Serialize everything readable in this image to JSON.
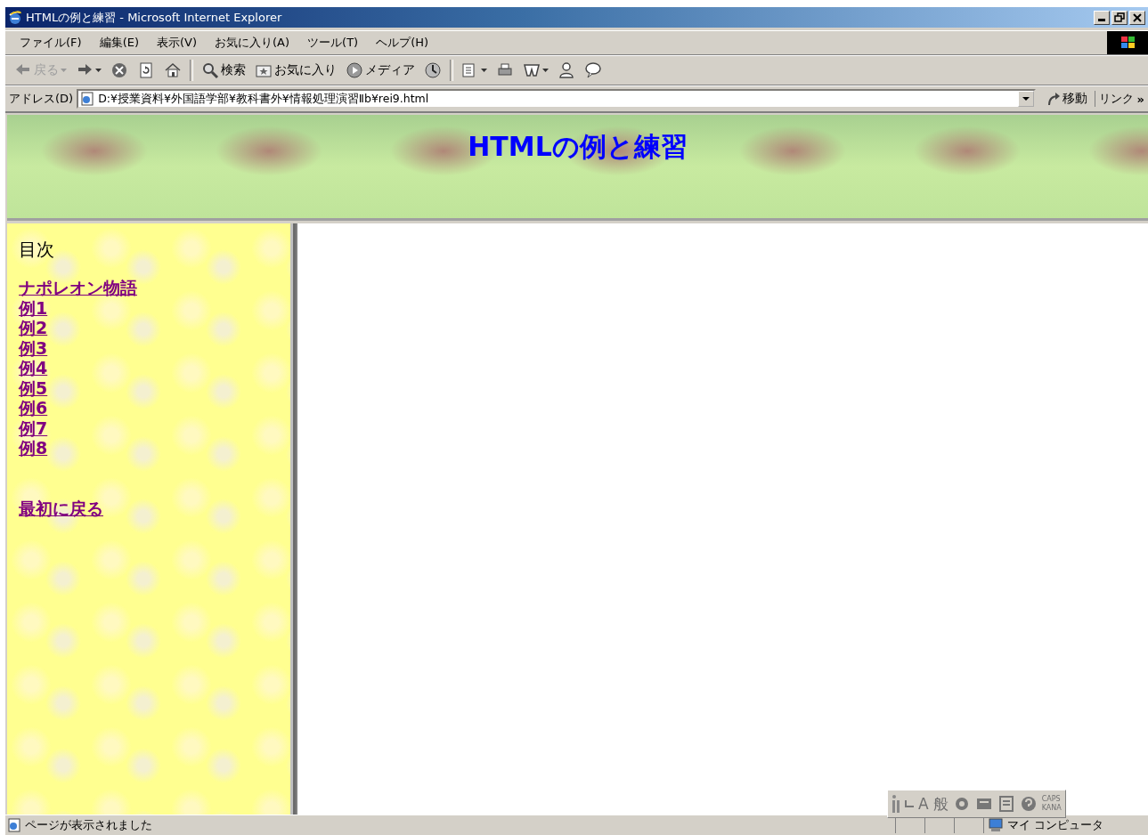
{
  "window": {
    "title": "HTMLの例と練習 - Microsoft Internet Explorer"
  },
  "menu": [
    "ファイル(F)",
    "編集(E)",
    "表示(V)",
    "お気に入り(A)",
    "ツール(T)",
    "ヘルプ(H)"
  ],
  "toolbar": [
    {
      "kind": "back",
      "label": "戻る",
      "disabled": true,
      "dropdown": true,
      "separator_after": false
    },
    {
      "kind": "forward",
      "disabled": false,
      "dropdown": true,
      "separator_after": false
    },
    {
      "kind": "stop",
      "disabled": false,
      "dropdown": false,
      "separator_after": false
    },
    {
      "kind": "refresh",
      "disabled": false,
      "dropdown": false,
      "separator_after": false
    },
    {
      "kind": "home",
      "disabled": false,
      "dropdown": false,
      "separator_after": true
    },
    {
      "kind": "search",
      "label": "検索",
      "disabled": false,
      "dropdown": false,
      "separator_after": false
    },
    {
      "kind": "favorites",
      "label": "お気に入り",
      "disabled": false,
      "dropdown": false,
      "separator_after": false
    },
    {
      "kind": "media",
      "label": "メディア",
      "disabled": false,
      "dropdown": false,
      "separator_after": false
    },
    {
      "kind": "history",
      "disabled": false,
      "dropdown": false,
      "separator_after": true
    },
    {
      "kind": "mail",
      "disabled": false,
      "dropdown": true,
      "separator_after": false
    },
    {
      "kind": "print",
      "disabled": false,
      "dropdown": false,
      "separator_after": false
    },
    {
      "kind": "edit",
      "disabled": false,
      "dropdown": true,
      "separator_after": false
    },
    {
      "kind": "discuss",
      "disabled": false,
      "dropdown": false,
      "separator_after": false
    },
    {
      "kind": "messenger",
      "disabled": false,
      "dropdown": false,
      "separator_after": false
    }
  ],
  "address": {
    "label": "アドレス(D)",
    "value": "D:¥授業資料¥外国語学部¥教科書外¥情報処理演習Ⅱb¥rei9.html",
    "go": "移動",
    "links": "リンク",
    "more": "»"
  },
  "page": {
    "heading": "HTMLの例と練習",
    "sidebar": {
      "title": "目次",
      "links": [
        "ナポレオン物語",
        "例1",
        "例2",
        "例3",
        "例4",
        "例5",
        "例6",
        "例7",
        "例8"
      ],
      "back_link": "最初に戻る"
    }
  },
  "status_bar": {
    "text": "ページが表示されました",
    "zone": "マイ コンピュータ"
  },
  "ime_bar": {
    "mode": "A",
    "conversion": "般",
    "caps": "CAPS",
    "kana": "KANA"
  }
}
